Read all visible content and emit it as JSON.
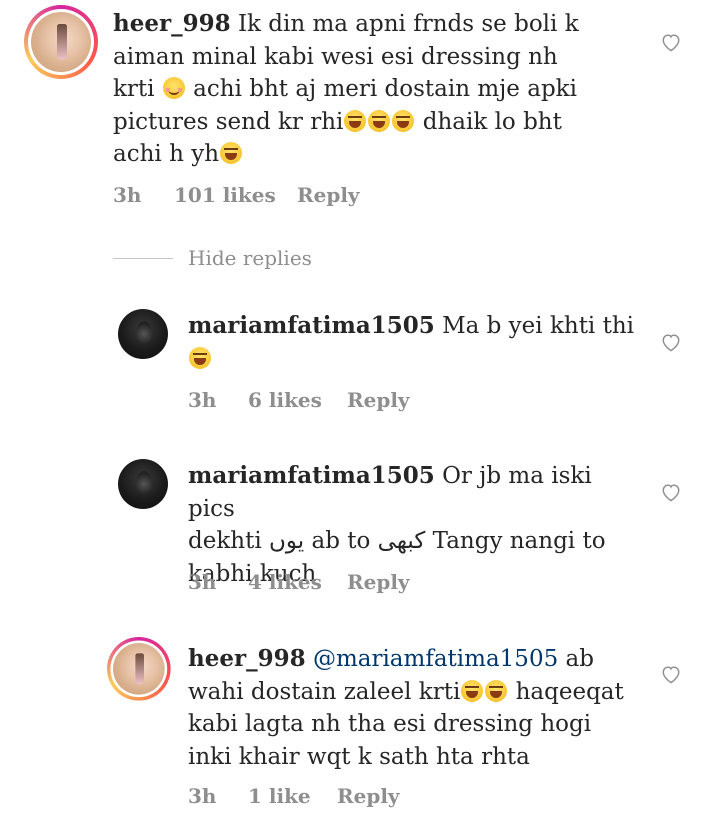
{
  "comments": [
    {
      "username": "heer_998",
      "segments": [
        "Ik din ma apni frnds se boli k",
        "aiman minal kabi wesi esi dressing nh",
        "krti",
        "achi bht  aj meri dostain mje apki",
        "pictures send kr rhi",
        "dhaik lo bht",
        "achi h yh"
      ],
      "time": "3h",
      "likes": "101 likes",
      "reply": "Reply"
    },
    {
      "username": "mariamfatima1505",
      "segments": [
        "Ma b yei khti thi"
      ],
      "time": "3h",
      "likes": "6 likes",
      "reply": "Reply"
    },
    {
      "username": "mariamfatima1505",
      "segments": [
        "Or jb ma iski pics",
        "dekhti",
        "یوں",
        "ab to",
        "کبھی",
        "Tangy nangi to",
        "kabhi kuch"
      ],
      "time": "3h",
      "likes": "4 likes",
      "reply": "Reply"
    },
    {
      "username": "heer_998",
      "mention": "@mariamfatima1505",
      "segments": [
        "ab",
        "wahi dostain zaleel krti",
        "haqeeqat",
        "kabi lagta nh tha esi dressing hogi",
        "inki khair wqt k sath hta rhta"
      ],
      "time": "3h",
      "likes": "1 like",
      "reply": "Reply"
    }
  ],
  "hide_replies": "Hide replies",
  "icons": {
    "like": "heart-outline-icon",
    "laugh": "face-with-tears-of-joy-icon",
    "smile": "smiling-face-icon"
  },
  "colors": {
    "text": "#262626",
    "meta": "#8e8e8e",
    "mention": "#00376b"
  }
}
